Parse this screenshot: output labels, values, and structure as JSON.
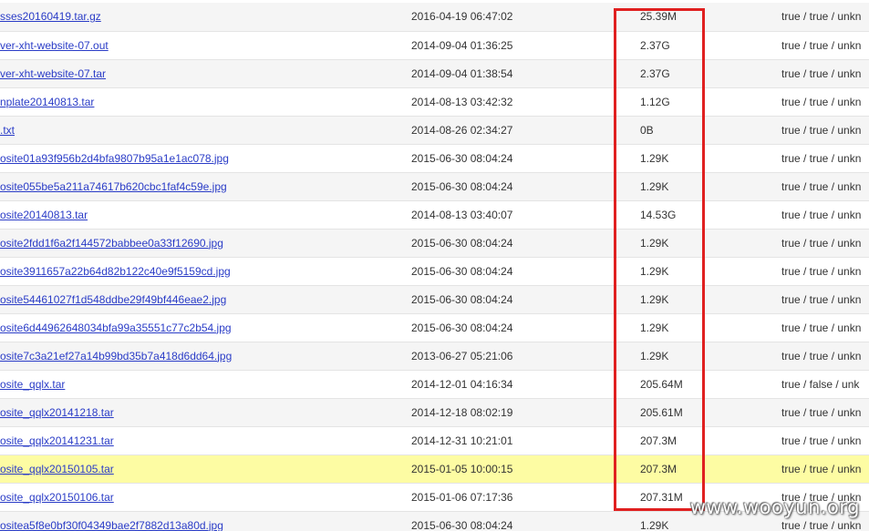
{
  "files": [
    {
      "name": "sses20160419.tar.gz",
      "date": "2016-04-19 06:47:02",
      "size": "25.39M",
      "flags": "true / true / unkn"
    },
    {
      "name": "ver-xht-website-07.out",
      "date": "2014-09-04 01:36:25",
      "size": "2.37G",
      "flags": "true / true / unkn"
    },
    {
      "name": "ver-xht-website-07.tar",
      "date": "2014-09-04 01:38:54",
      "size": "2.37G",
      "flags": "true / true / unkn"
    },
    {
      "name": "nplate20140813.tar",
      "date": "2014-08-13 03:42:32",
      "size": "1.12G",
      "flags": "true / true / unkn"
    },
    {
      "name": ".txt",
      "date": "2014-08-26 02:34:27",
      "size": "0B",
      "flags": "true / true / unkn"
    },
    {
      "name": "osite01a93f956b2d4bfa9807b95a1e1ac078.jpg",
      "date": "2015-06-30 08:04:24",
      "size": "1.29K",
      "flags": "true / true / unkn"
    },
    {
      "name": "osite055be5a211a74617b620cbc1faf4c59e.jpg",
      "date": "2015-06-30 08:04:24",
      "size": "1.29K",
      "flags": "true / true / unkn"
    },
    {
      "name": "osite20140813.tar",
      "date": "2014-08-13 03:40:07",
      "size": "14.53G",
      "flags": "true / true / unkn"
    },
    {
      "name": "osite2fdd1f6a2f144572babbee0a33f12690.jpg",
      "date": "2015-06-30 08:04:24",
      "size": "1.29K",
      "flags": "true / true / unkn"
    },
    {
      "name": "osite3911657a22b64d82b122c40e9f5159cd.jpg",
      "date": "2015-06-30 08:04:24",
      "size": "1.29K",
      "flags": "true / true / unkn"
    },
    {
      "name": "osite54461027f1d548ddbe29f49bf446eae2.jpg",
      "date": "2015-06-30 08:04:24",
      "size": "1.29K",
      "flags": "true / true / unkn"
    },
    {
      "name": "osite6d44962648034bfa99a35551c77c2b54.jpg",
      "date": "2015-06-30 08:04:24",
      "size": "1.29K",
      "flags": "true / true / unkn"
    },
    {
      "name": "osite7c3a21ef27a14b99bd35b7a418d6dd64.jpg",
      "date": "2013-06-27 05:21:06",
      "size": "1.29K",
      "flags": "true / true / unkn"
    },
    {
      "name": "osite_qqlx.tar",
      "date": "2014-12-01 04:16:34",
      "size": "205.64M",
      "flags": "true / false / unk"
    },
    {
      "name": "osite_qqlx20141218.tar",
      "date": "2014-12-18 08:02:19",
      "size": "205.61M",
      "flags": "true / true / unkn"
    },
    {
      "name": "osite_qqlx20141231.tar",
      "date": "2014-12-31 10:21:01",
      "size": "207.3M",
      "flags": "true / true / unkn"
    },
    {
      "name": "osite_qqlx20150105.tar",
      "date": "2015-01-05 10:00:15",
      "size": "207.3M",
      "flags": "true / true / unkn",
      "highlighted": true
    },
    {
      "name": "osite_qqlx20150106.tar",
      "date": "2015-01-06 07:17:36",
      "size": "207.31M",
      "flags": "true / true / unkn"
    },
    {
      "name": "ositea5f8e0bf30f04349bae2f7882d13a80d.jpg",
      "date": "2015-06-30 08:04:24",
      "size": "1.29K",
      "flags": "true / true / unkn"
    }
  ],
  "watermark": "www.wooyun.org",
  "colors": {
    "link": "#2a3cc7",
    "highlight_row": "#fdfca3",
    "annotation_box": "#e02020",
    "row_alt": "#f5f5f5"
  }
}
